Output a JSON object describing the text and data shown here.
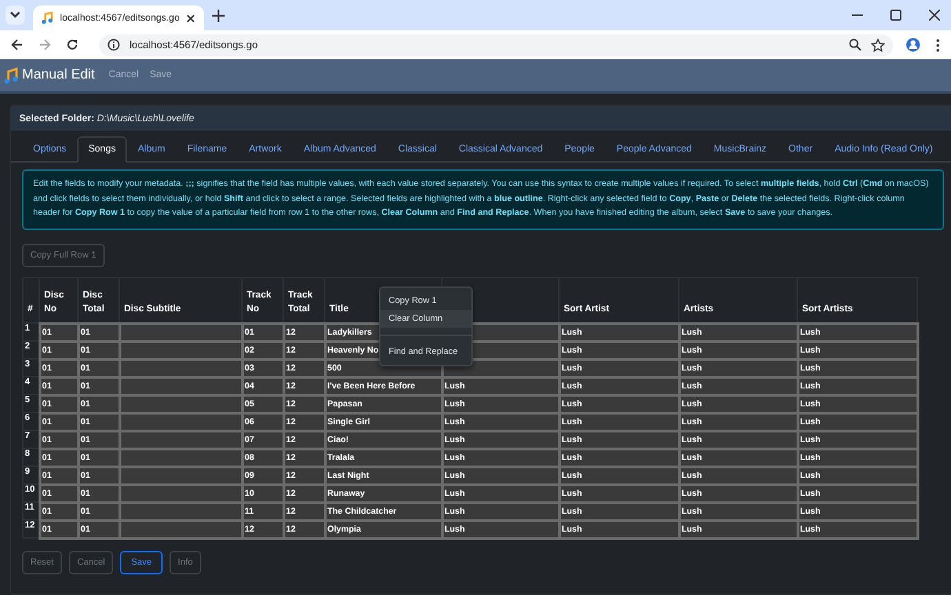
{
  "browser": {
    "tab_title": "localhost:4567/editsongs.go",
    "url": "localhost:4567/editsongs.go"
  },
  "app": {
    "title": "Manual Edit",
    "actions": [
      {
        "label": "Cancel",
        "disabled": true
      },
      {
        "label": "Save",
        "disabled": true
      }
    ]
  },
  "folder": {
    "label": "Selected Folder:",
    "path": "D:\\Music\\Lush\\Lovelife"
  },
  "tabs": [
    {
      "label": "Options",
      "selected": false
    },
    {
      "label": "Songs",
      "selected": true
    },
    {
      "label": "Album",
      "selected": false
    },
    {
      "label": "Filename",
      "selected": false
    },
    {
      "label": "Artwork",
      "selected": false
    },
    {
      "label": "Album Advanced",
      "selected": false
    },
    {
      "label": "Classical",
      "selected": false
    },
    {
      "label": "Classical Advanced",
      "selected": false
    },
    {
      "label": "People",
      "selected": false
    },
    {
      "label": "People Advanced",
      "selected": false
    },
    {
      "label": "MusicBrainz",
      "selected": false
    },
    {
      "label": "Other",
      "selected": false
    },
    {
      "label": "Audio Info (Read Only)",
      "selected": false
    }
  ],
  "info": "Edit the fields to modify your metadata. **;;;** signifies that the field has multiple values, with each value stored separately. You can use this syntax to create multiple values if required. To select **multiple fields**, hold **Ctrl** (**Cmd** on macOS) and click fields to select them individually, or hold **Shift** and click to select a range. Selected fields are highlighted with a **blue outline**. Right-click any selected field to **Copy**, **Paste** or **Delete** the selected fields. Right-click column header for **Copy Row 1** to copy the value of a particular field from row 1 to the other rows, **Clear Column** and **Find and Replace**. When you have finished editing the album, select **Save** to save your changes.",
  "copy_button": {
    "label": "Copy Full Row 1",
    "disabled": true
  },
  "table": {
    "columns": [
      {
        "label": "#"
      },
      {
        "label": "Disc No"
      },
      {
        "label": "Disc Total"
      },
      {
        "label": "Disc Subtitle"
      },
      {
        "label": "Track No"
      },
      {
        "label": "Track Total"
      },
      {
        "label": "Title"
      },
      {},
      {
        "label": "Sort Artist"
      },
      {
        "label": "Artists"
      },
      {
        "label": "Sort Artists"
      }
    ],
    "rows": [
      {
        "cells": [
          "1",
          "01",
          "01",
          null,
          "01",
          "12",
          "Ladykillers",
          null,
          "Lush",
          "Lush",
          "Lush"
        ]
      },
      {
        "cells": [
          "2",
          "01",
          "01",
          null,
          "02",
          "12",
          "Heavenly No",
          null,
          "Lush",
          "Lush",
          "Lush"
        ]
      },
      {
        "cells": [
          "3",
          "01",
          "01",
          null,
          "03",
          "12",
          "500",
          null,
          "Lush",
          "Lush",
          "Lush"
        ]
      },
      {
        "cells": [
          "4",
          "01",
          "01",
          null,
          "04",
          "12",
          "I've Been Here Before",
          "Lush",
          "Lush",
          "Lush",
          "Lush"
        ]
      },
      {
        "cells": [
          "5",
          "01",
          "01",
          null,
          "05",
          "12",
          "Papasan",
          "Lush",
          "Lush",
          "Lush",
          "Lush"
        ]
      },
      {
        "cells": [
          "6",
          "01",
          "01",
          null,
          "06",
          "12",
          "Single Girl",
          "Lush",
          "Lush",
          "Lush",
          "Lush"
        ]
      },
      {
        "cells": [
          "7",
          "01",
          "01",
          null,
          "07",
          "12",
          "Ciao!",
          "Lush",
          "Lush",
          "Lush",
          "Lush"
        ]
      },
      {
        "cells": [
          "8",
          "01",
          "01",
          null,
          "08",
          "12",
          "Tralala",
          "Lush",
          "Lush",
          "Lush",
          "Lush"
        ]
      },
      {
        "cells": [
          "9",
          "01",
          "01",
          null,
          "09",
          "12",
          "Last Night",
          "Lush",
          "Lush",
          "Lush",
          "Lush"
        ]
      },
      {
        "cells": [
          "10",
          "01",
          "01",
          null,
          "10",
          "12",
          "Runaway",
          "Lush",
          "Lush",
          "Lush",
          "Lush"
        ]
      },
      {
        "cells": [
          "11",
          "01",
          "01",
          null,
          "11",
          "12",
          "The Childcatcher",
          "Lush",
          "Lush",
          "Lush",
          "Lush"
        ]
      },
      {
        "cells": [
          "12",
          "01",
          "01",
          null,
          "12",
          "12",
          "Olympia",
          "Lush",
          "Lush",
          "Lush",
          "Lush"
        ]
      }
    ]
  },
  "context_menu": [
    {
      "kind": "item",
      "label": "Copy Row 1",
      "selected": false
    },
    {
      "kind": "item",
      "label": "Clear Column",
      "selected": true
    },
    {
      "kind": "divider"
    },
    {
      "kind": "item",
      "label": "Find and Replace",
      "selected": false
    }
  ],
  "buttons": [
    {
      "label": "Reset",
      "kind": "plain",
      "disabled": true
    },
    {
      "label": "Cancel",
      "kind": "plain",
      "disabled": true
    },
    {
      "label": "Save",
      "kind": "primary",
      "disabled": false
    },
    {
      "label": "Info",
      "kind": "plain",
      "disabled": true
    }
  ]
}
